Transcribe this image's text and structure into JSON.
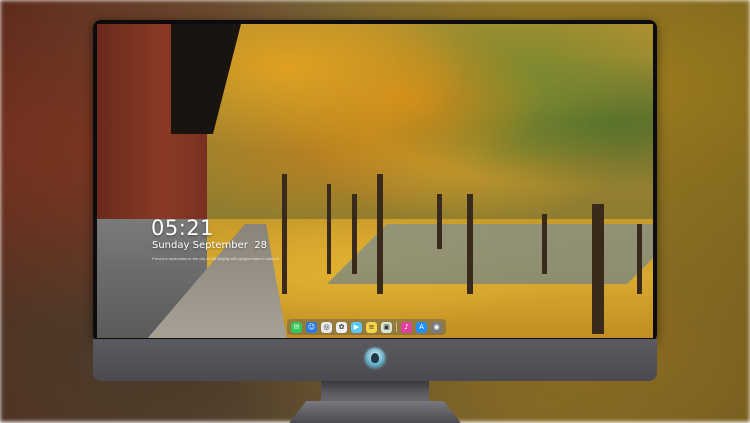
{
  "lock_screen": {
    "time": "05:21",
    "date": "Sunday September  28",
    "caption": "Previous landmarks in the city of old Beijing with gingko trees in autumn"
  },
  "dock": {
    "apps": [
      {
        "name": "messages",
        "glyph": "✉",
        "color": "#34c759"
      },
      {
        "name": "finder",
        "glyph": "☺",
        "color": "#2a7ae2"
      },
      {
        "name": "safari",
        "glyph": "◎",
        "color": "#e8e8e8"
      },
      {
        "name": "photos",
        "glyph": "✿",
        "color": "#f0f0f0"
      },
      {
        "name": "facetime",
        "glyph": "▶",
        "color": "#5ac8fa"
      },
      {
        "name": "notes",
        "glyph": "≡",
        "color": "#f5d547"
      },
      {
        "name": "preview",
        "glyph": "▣",
        "color": "#d9e6d0"
      },
      {
        "name": "itunes",
        "glyph": "♪",
        "color": "#e040a0"
      },
      {
        "name": "app-store",
        "glyph": "A",
        "color": "#1e90ff"
      },
      {
        "name": "camera",
        "glyph": "◉",
        "color": "#7a7a80"
      }
    ]
  },
  "colors": {
    "bezel": "#0c0c0e",
    "chin": "#4a4a50",
    "accent": "#6ab0c8"
  },
  "icons": {
    "brand_logo": "alien-logo-icon"
  }
}
